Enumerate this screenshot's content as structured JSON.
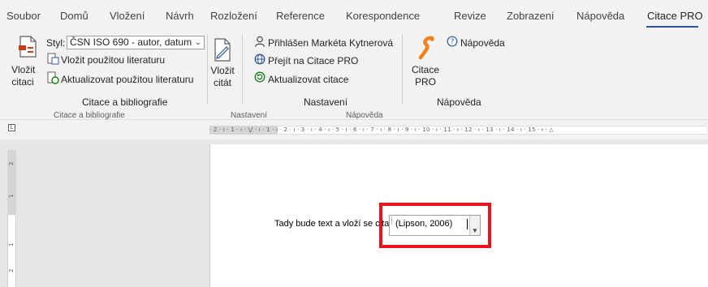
{
  "tabs": [
    {
      "id": "soubor",
      "label": "Soubor"
    },
    {
      "id": "domu",
      "label": "Domů"
    },
    {
      "id": "vlozeni",
      "label": "Vložení"
    },
    {
      "id": "navrh",
      "label": "Návrh"
    },
    {
      "id": "rozlozeni",
      "label": "Rozložení"
    },
    {
      "id": "reference",
      "label": "Reference"
    },
    {
      "id": "korespondence",
      "label": "Korespondence"
    },
    {
      "id": "revize",
      "label": "Revize"
    },
    {
      "id": "zobrazeni",
      "label": "Zobrazení"
    },
    {
      "id": "napoveda",
      "label": "Nápověda"
    },
    {
      "id": "citace-pro",
      "label": "Citace PRO",
      "active": true
    }
  ],
  "ribbon": {
    "insert_citation": {
      "line1": "Vložit",
      "line2": "citaci"
    },
    "style_label": "Styl:",
    "style_value": "ČSN ISO 690 - autor, datum",
    "insert_bibliography": "Vložit použitou literaturu",
    "update_bibliography": "Aktualizovat použitou literaturu",
    "group_citations": "Citace a bibliografie",
    "insert_cited": {
      "line1": "Vložit",
      "line2": "citát"
    },
    "logged_in": "Přihlášen Markéta Kytnerová",
    "go_to_citace": "Přejít na Citace PRO",
    "update_citation": "Aktualizovat citace",
    "group_settings": "Nastavení",
    "citace_pro_button": {
      "line1": "Citace",
      "line2": "PRO"
    },
    "help": "Nápověda",
    "group_help": "Nápověda",
    "sub_labels": [
      "Citace a bibliografie",
      "Nastavení",
      "Nápověda"
    ]
  },
  "ruler": {
    "numbers": "· 2 · ı · 1 · ı · ⋁ · ı · 1 · ı · 2 · ı · 3 · ı · 4 · ı · 5 · ı · 6 · ı · 7 · ı · 8 · ı · 9 · ı · 10 · ı · 11 · ı · 12 · ı · 13 · ı · 14 · ı · 15 · ı · △",
    "tab_stop": "L",
    "vertical": [
      "2",
      "1",
      "1",
      "2"
    ]
  },
  "document": {
    "text": "Tady bude text a vloží se citace",
    "citation": "(Lipson, 2006)"
  },
  "colors": {
    "accent": "#2b579a",
    "highlight": "#e8141c",
    "ribbon_bg": "#f3f2f1"
  }
}
